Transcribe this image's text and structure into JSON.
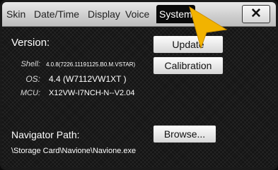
{
  "tabs": [
    {
      "label": "Skin",
      "active": false
    },
    {
      "label": "Date/Time",
      "active": false
    },
    {
      "label": "Display",
      "active": false
    },
    {
      "label": "Voice",
      "active": false
    },
    {
      "label": "System",
      "active": true
    }
  ],
  "close_label": "✕",
  "version": {
    "heading": "Version:",
    "shell_key": "Shell:",
    "shell_value": "4.0.8(7226.11191125.B0.M.VSTAR)",
    "os_key": "OS:",
    "os_value": "4.4 (W7112VW1XT  )",
    "mcu_key": "MCU:",
    "mcu_value": "X12VW-I7NCH-N--V2.04"
  },
  "buttons": {
    "update": "Update",
    "calibration": "Calibration",
    "browse": "Browse..."
  },
  "navigator": {
    "heading": "Navigator Path:",
    "path": "\\Storage Card\\Navione\\Navione.exe"
  },
  "colors": {
    "pointer_arrow": "#f2b300",
    "active_tab_bg": "#0a0a0a",
    "tabbar_bg": "#d4d4d4"
  },
  "icons": {
    "close": "close-icon",
    "pointer": "pointer-arrow-icon"
  }
}
